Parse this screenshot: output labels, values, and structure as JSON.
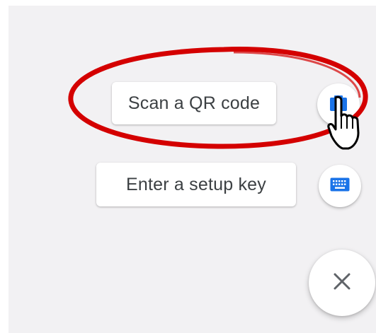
{
  "speed_dial": {
    "scan_qr_label": "Scan a QR code",
    "setup_key_label": "Enter a setup key"
  },
  "icons": {
    "camera": "camera-icon",
    "keyboard": "keyboard-icon",
    "close": "close-icon",
    "cursor": "mouse-pointer-icon"
  },
  "colors": {
    "accent": "#1a73e8",
    "annotation": "#d40000",
    "text": "#3c4043",
    "close_icon": "#5f6368"
  }
}
